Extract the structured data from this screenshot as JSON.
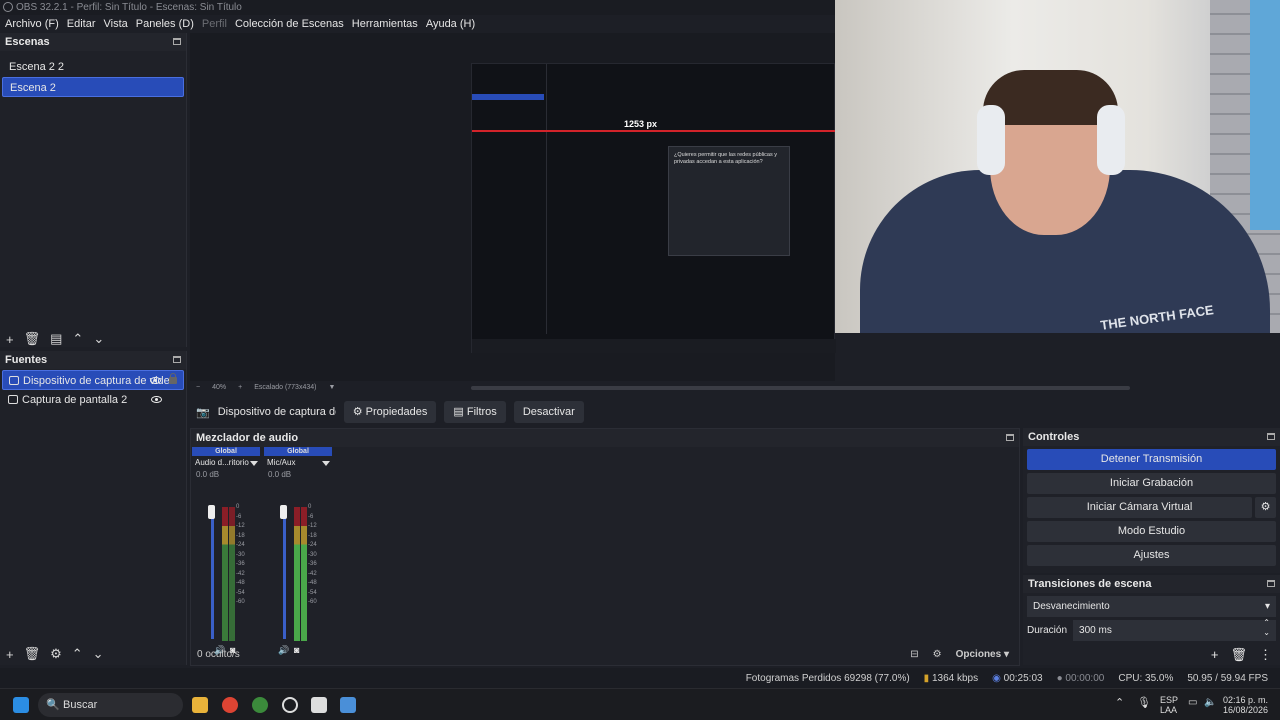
{
  "window": {
    "title": "OBS 32.2.1 - Perfil: Sin Título - Escenas: Sin Título"
  },
  "menu": [
    "Archivo (F)",
    "Editar",
    "Vista",
    "Paneles (D)",
    "Perfil",
    "Colección de Escenas",
    "Herramientas",
    "Ayuda (H)"
  ],
  "scenes": {
    "title": "Escenas",
    "items": [
      "Escena 2 2",
      "Escena 2"
    ],
    "selected": "Escena 2"
  },
  "sources": {
    "title": "Fuentes",
    "items": [
      "Dispositivo de captura de video",
      "Captura de pantalla 2"
    ]
  },
  "preview": {
    "nested_label": "1253 px",
    "dialog_title": "¿Quieres permitir que las redes públicas y privadas accedan a esta aplicación?",
    "zoom": "40%",
    "scale_label": "Escalado (773x434)",
    "webcam_text": "THE NORTH FACE"
  },
  "context": {
    "source": "Dispositivo de captura de v",
    "properties": "Propiedades",
    "filters": "Filtros",
    "deactivate": "Desactivar"
  },
  "mixer": {
    "title": "Mezclador de audio",
    "channels": [
      {
        "header": "Global",
        "name": "Audio d...ritorio",
        "db": "0.0 dB"
      },
      {
        "header": "Global",
        "name": "Mic/Aux",
        "db": "0.0 dB"
      }
    ],
    "scale": [
      "0",
      "-6",
      "-12",
      "-18",
      "-24",
      "-30",
      "-36",
      "-42",
      "-48",
      "-54",
      "-60"
    ],
    "hidden": "0 oculto/s",
    "options": "Opciones"
  },
  "controls": {
    "title": "Controles",
    "stop_stream": "Detener Transmisión",
    "start_record": "Iniciar Grabación",
    "start_virtualcam": "Iniciar Cámara Virtual",
    "studio_mode": "Modo Estudio",
    "settings": "Ajustes"
  },
  "transitions": {
    "title": "Transiciones de escena",
    "type": "Desvanecimiento",
    "duration_label": "Duración",
    "duration": "300 ms"
  },
  "status": {
    "dropped": "Fotogramas Perdidos 69298 (77.0%)",
    "bitrate": "1364 kbps",
    "stream_time": "00:25:03",
    "rec_time": "00:00:00",
    "cpu": "CPU: 35.0%",
    "fps": "50.95 / 59.94 FPS"
  },
  "taskbar": {
    "search": "Buscar",
    "lang1": "ESP",
    "lang2": "LAA",
    "time": "02:16 p. m.",
    "date": "16/08/2026"
  },
  "colors": {
    "accent": "#284cb8",
    "bg": "#1d1f26",
    "panel": "#1f2128"
  }
}
